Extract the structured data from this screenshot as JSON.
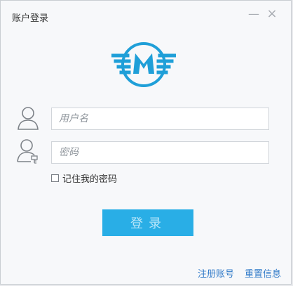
{
  "window": {
    "title": "账户登录",
    "minimize_symbol": "—",
    "close_symbol": "×"
  },
  "logo": {
    "icon_name": "metro-logo-icon",
    "letter": "M",
    "color": "#1f9fd8"
  },
  "form": {
    "username_placeholder": "用户名",
    "password_placeholder": "密码",
    "remember_label": "记住我的密码",
    "login_label": "登录"
  },
  "links": {
    "register": "注册账号",
    "reset": "重置信息"
  },
  "icons": {
    "user": "user-icon",
    "password_user": "user-key-icon"
  },
  "colors": {
    "accent": "#29aee6",
    "link": "#2f79c8"
  }
}
